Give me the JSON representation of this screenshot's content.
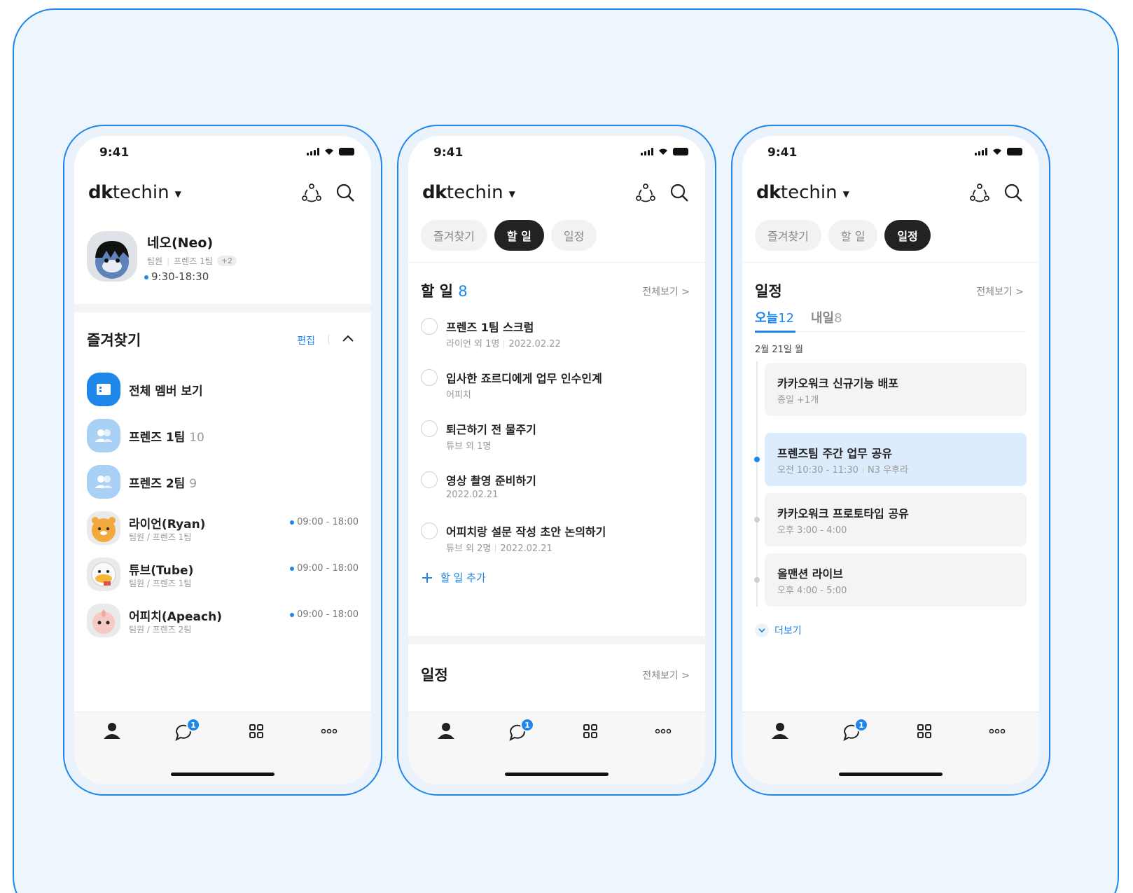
{
  "status": {
    "time": "9:41"
  },
  "brand": {
    "bold": "dk",
    "rest": "techin"
  },
  "tabs": [
    "즐겨찾기",
    "할 일",
    "일정"
  ],
  "chat_badge": "1",
  "phone1": {
    "profile": {
      "name": "네오(Neo)",
      "role": "팀원",
      "team": "프렌즈 1팀",
      "extra": "+2",
      "hours": "9:30-18:30"
    },
    "favorites": {
      "title": "즐겨찾기",
      "edit": "편집",
      "items": [
        {
          "name": "전체 멤버 보기",
          "count": "",
          "sub": "",
          "hours": ""
        },
        {
          "name": "프렌즈 1팀",
          "count": "10",
          "sub": "",
          "hours": ""
        },
        {
          "name": "프렌즈 2팀",
          "count": "9",
          "sub": "",
          "hours": ""
        },
        {
          "name": "라이언(Ryan)",
          "count": "",
          "sub": "팀원 / 프렌즈 1팀",
          "hours": "09:00 - 18:00"
        },
        {
          "name": "튜브(Tube)",
          "count": "",
          "sub": "팀원 / 프렌즈 1팀",
          "hours": "09:00 - 18:00"
        },
        {
          "name": "어피치(Apeach)",
          "count": "",
          "sub": "팀원 / 프렌즈 2팀",
          "hours": "09:00 - 18:00"
        }
      ]
    }
  },
  "phone2": {
    "todo": {
      "title": "할 일",
      "count": "8",
      "view_all": "전체보기 >",
      "items": [
        {
          "title": "프렌즈 1팀 스크럼",
          "who": "라이언 외 1명",
          "date": "2022.02.22"
        },
        {
          "title": "입사한 죠르디에게 업무 인수인계",
          "who": "어피치",
          "date": ""
        },
        {
          "title": "퇴근하기 전 물주기",
          "who": "튜브 외 1명",
          "date": ""
        },
        {
          "title": "영상 촬영 준비하기",
          "who": "2022.02.21",
          "date": ""
        },
        {
          "title": "어피치랑 설문 작성 초안 논의하기",
          "who": "튜브 외 2명",
          "date": "2022.02.21"
        }
      ],
      "add_label": "할 일 추가"
    },
    "schedule": {
      "title": "일정",
      "view_all": "전체보기 >"
    }
  },
  "phone3": {
    "schedule": {
      "title": "일정",
      "view_all": "전체보기 >",
      "today_label": "오늘",
      "today_count": "12",
      "tomorrow_label": "내일",
      "tomorrow_count": "8",
      "date": "2월 21일 월",
      "events": [
        {
          "title": "카카오워크 신규기능 배포",
          "time": "종일 +1개",
          "place": ""
        },
        {
          "title": "프렌즈팀 주간 업무 공유",
          "time": "오전 10:30 - 11:30",
          "place": "N3 우후라"
        },
        {
          "title": "카카오워크 프로토타입 공유",
          "time": "오후 3:00 - 4:00",
          "place": ""
        },
        {
          "title": "올맨션 라이브",
          "time": "오후 4:00 - 5:00",
          "place": ""
        }
      ],
      "more": "더보기"
    }
  },
  "colors": {
    "accent": "#1f86ea",
    "frame": "#1f86ea",
    "background": "#edf5fd"
  }
}
